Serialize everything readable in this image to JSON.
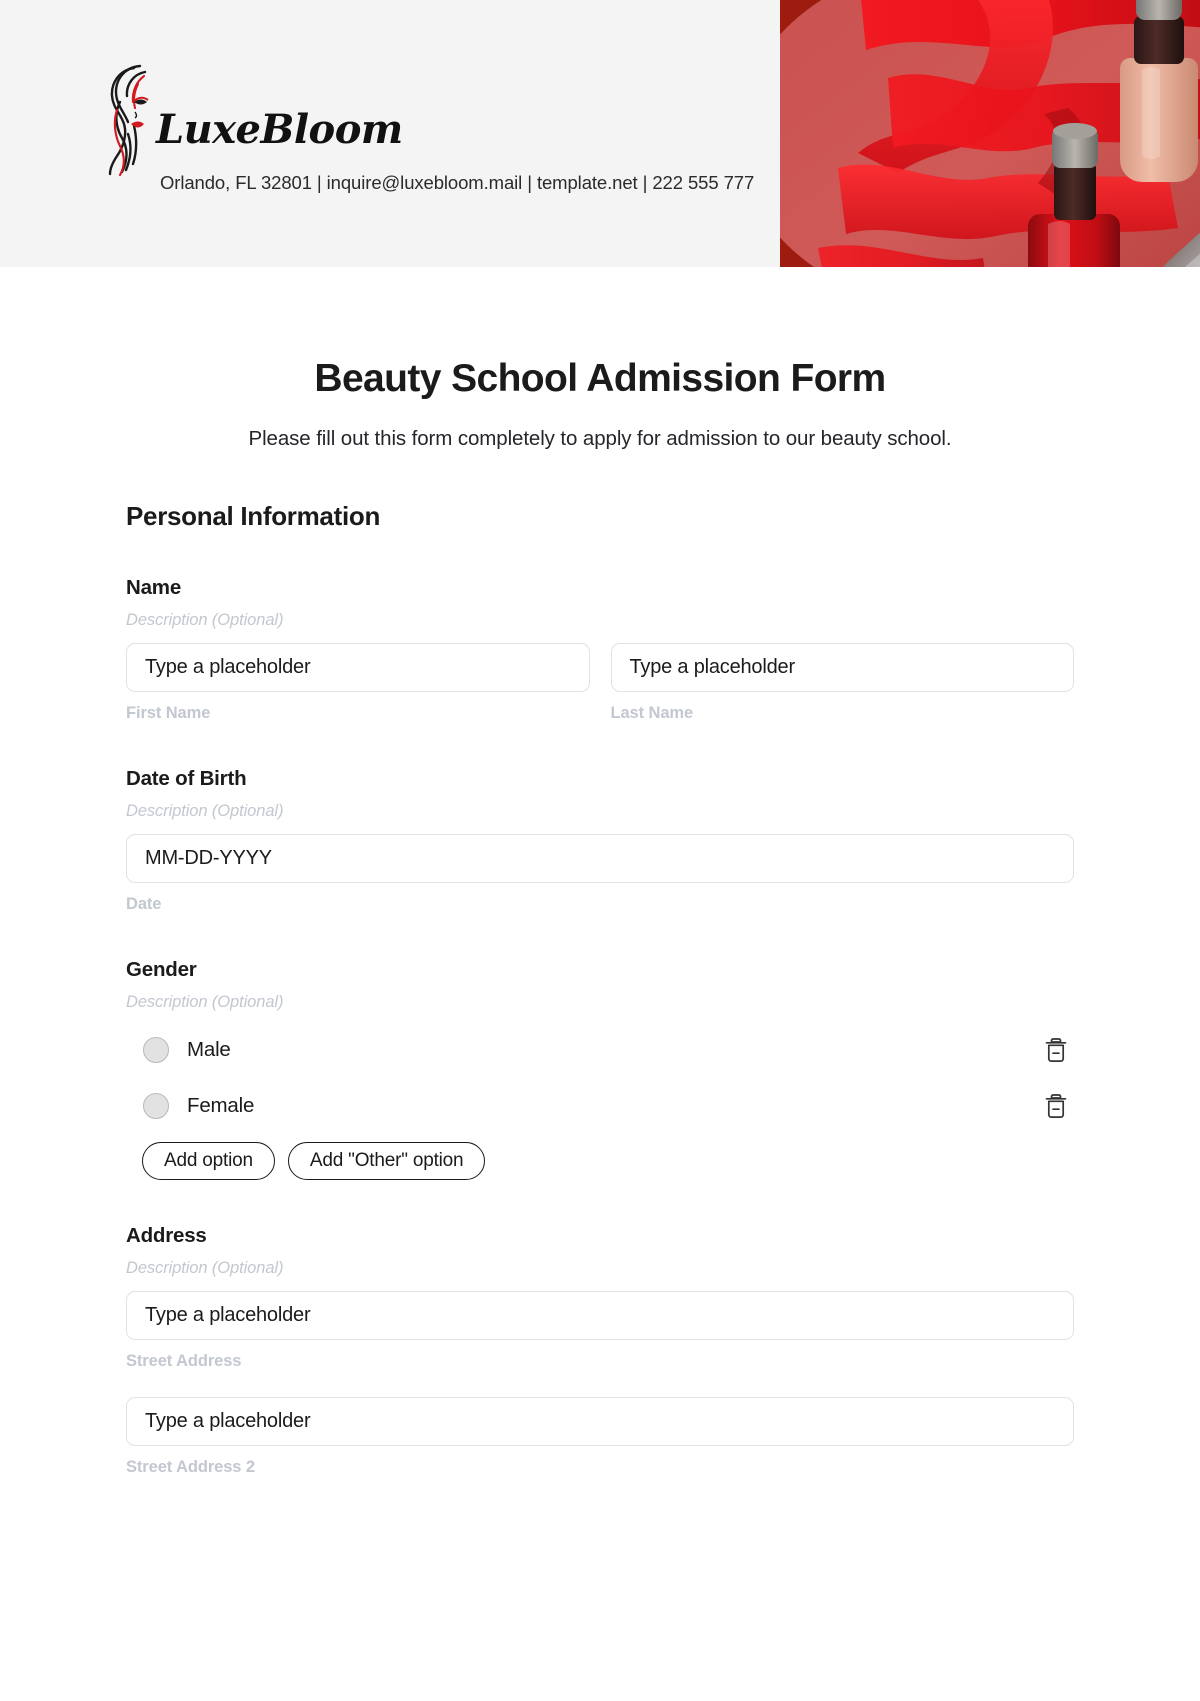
{
  "brand": {
    "logo_icon": "woman-face-logo-icon",
    "name": "LuxeBloom",
    "contact": "Orlando, FL 32801 | inquire@luxebloom.mail | template.net | 222 555 777",
    "header_bg": "#f4f4f4",
    "accent_red": "#9e1b10",
    "accent_pink": "#e9dcdb"
  },
  "form": {
    "title": "Beauty School Admission Form",
    "subtitle": "Please fill out this form completely to apply for admission to our beauty school.",
    "section_title": "Personal Information",
    "description_placeholder": "Description (Optional)"
  },
  "fields": {
    "name": {
      "label": "Name",
      "description": "Description (Optional)",
      "first": {
        "value": "Type a placeholder",
        "sub_label": "First Name"
      },
      "last": {
        "value": "Type a placeholder",
        "sub_label": "Last Name"
      }
    },
    "dob": {
      "label": "Date of Birth",
      "description": "Description (Optional)",
      "value": "MM-DD-YYYY",
      "sub_label": "Date"
    },
    "gender": {
      "label": "Gender",
      "description": "Description (Optional)",
      "options": [
        {
          "label": "Male",
          "delete_icon": "trash-icon"
        },
        {
          "label": "Female",
          "delete_icon": "trash-icon"
        }
      ],
      "add_option_label": "Add option",
      "add_other_label": "Add \"Other\" option"
    },
    "address": {
      "label": "Address",
      "description": "Description (Optional)",
      "street1": {
        "value": "Type a placeholder",
        "sub_label": "Street Address"
      },
      "street2": {
        "value": "Type a placeholder",
        "sub_label": "Street Address 2"
      }
    }
  }
}
